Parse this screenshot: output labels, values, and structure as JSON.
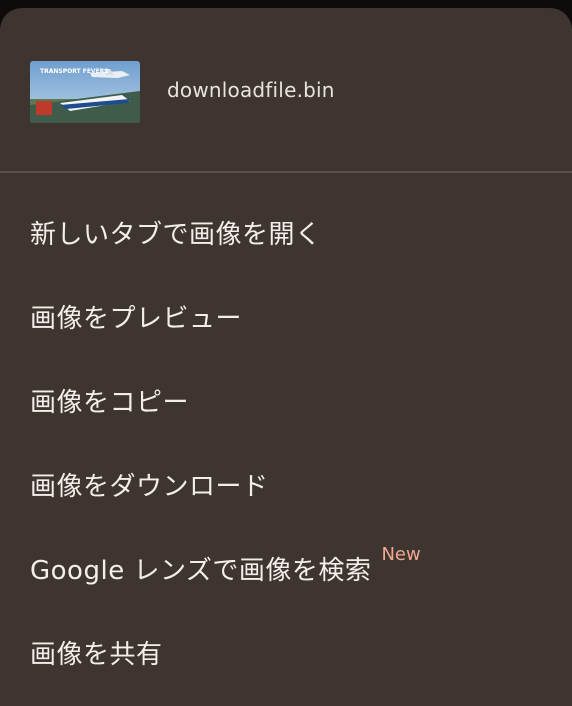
{
  "header": {
    "thumbnail_text": "TRANSPORT FEVER2",
    "filename": "downloadfile.bin"
  },
  "menu": {
    "items": [
      {
        "label": "新しいタブで画像を開く"
      },
      {
        "label": "画像をプレビュー"
      },
      {
        "label": "画像をコピー"
      },
      {
        "label": "画像をダウンロード"
      },
      {
        "label": "Google レンズで画像を検索",
        "badge": "New"
      },
      {
        "label": "画像を共有"
      }
    ]
  },
  "colors": {
    "sheet_background": "#3e3430",
    "text": "#f3eeea",
    "badge": "#f0a78f",
    "divider": "#5a4f4a"
  }
}
